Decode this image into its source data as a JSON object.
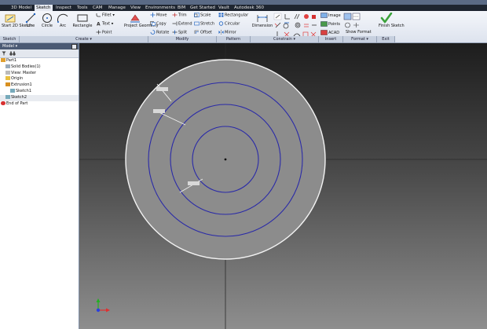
{
  "app": {
    "tabs": [
      "3D Model",
      "Sketch",
      "Inspect",
      "Tools",
      "CAM",
      "Manage",
      "View",
      "Environments",
      "BIM",
      "Get Started",
      "Vault",
      "Autodesk 360"
    ],
    "active_tab": "Sketch"
  },
  "ribbon": {
    "panels": [
      "Sketch",
      "Create",
      "Modify",
      "Pattern",
      "Constrain",
      "Insert",
      "Format",
      "Exit"
    ],
    "start_sketch": "Start 2D Sketch",
    "line": "Line",
    "circle": "Circle",
    "arc": "Arc",
    "rectangle": "Rectangle",
    "fillet": "Fillet",
    "text": "Text",
    "point": "Point",
    "project_geometry": "Project Geometry",
    "move": "Move",
    "copy": "Copy",
    "rotate": "Rotate",
    "trim": "Trim",
    "extend": "Extend",
    "split": "Split",
    "scale": "Scale",
    "stretch": "Stretch",
    "offset": "Offset",
    "rectangular": "Rectangular",
    "circular": "Circular",
    "mirror": "Mirror",
    "dimension": "Dimension",
    "image": "Image",
    "points": "Points",
    "acad": "ACAD",
    "show_format": "Show Format",
    "finish_sketch": "Finish Sketch",
    "dropdown_arrow": "▾"
  },
  "browser": {
    "title": "Model",
    "items": [
      "Part1",
      "Solid Bodies(1)",
      "View: Master",
      "Origin",
      "Extrusion1",
      "Sketch1",
      "Sketch2",
      "End of Part"
    ]
  },
  "colors": {
    "sketch_curve": "#2a2aa8",
    "solid_face": "#8c8c8c",
    "ribbon_bg": "#eef1f6",
    "exit_green": "#3aa23a"
  }
}
